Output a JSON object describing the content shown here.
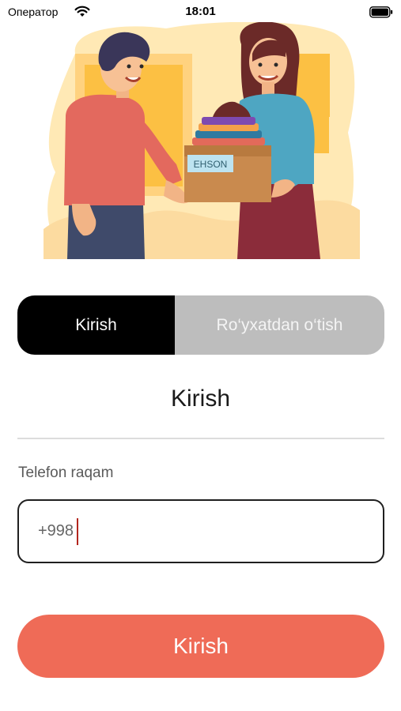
{
  "status_bar": {
    "carrier": "Оператор",
    "time": "18:01"
  },
  "hero": {
    "box_label": "EHSON"
  },
  "tabs": {
    "login": "Kirish",
    "register": "Ro‘yxatdan o‘tish"
  },
  "form": {
    "title": "Kirish",
    "phone_label": "Telefon raqam",
    "phone_prefix": "+998",
    "submit_label": "Kirish"
  },
  "colors": {
    "active_tab": "#000000",
    "inactive_tab": "#bdbdbd",
    "submit": "#ef6b57",
    "caret": "#b3261e"
  }
}
